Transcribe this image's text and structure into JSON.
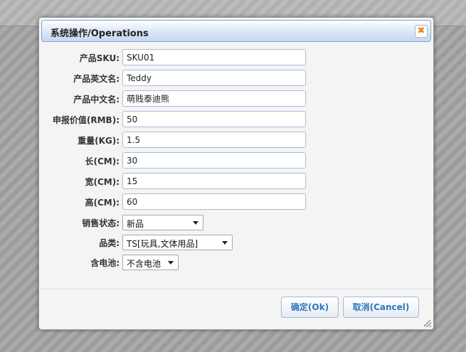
{
  "dialog": {
    "title": "系统操作/Operations",
    "close_glyph": "✖"
  },
  "fields": {
    "sku": {
      "label": "产品SKU:",
      "value": "SKU01"
    },
    "name_en": {
      "label": "产品英文名:",
      "value": "Teddy"
    },
    "name_cn": {
      "label": "产品中文名:",
      "value": "萌贱泰迪熊"
    },
    "declared_value": {
      "label": "申报价值(RMB):",
      "value": "50"
    },
    "weight": {
      "label": "重量(KG):",
      "value": "1.5"
    },
    "length": {
      "label": "长(CM):",
      "value": "30"
    },
    "width": {
      "label": "宽(CM):",
      "value": "15"
    },
    "height": {
      "label": "高(CM):",
      "value": "60"
    },
    "sales_status": {
      "label": "销售状态:",
      "value": "新品"
    },
    "category": {
      "label": "品类:",
      "value": "TS[玩具,文体用品]"
    },
    "battery": {
      "label": "含电池:",
      "value": "不含电池"
    }
  },
  "buttons": {
    "ok": "确定(Ok)",
    "cancel": "取消(Cancel)"
  }
}
